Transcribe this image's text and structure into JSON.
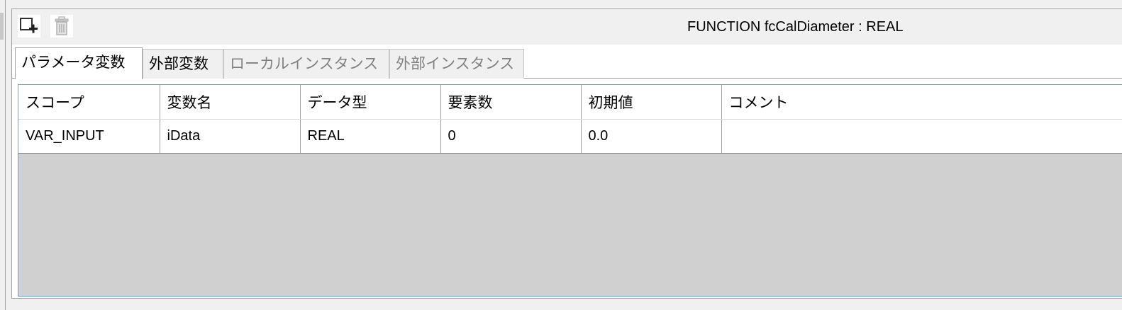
{
  "toolbar": {
    "add_icon": "add-row-icon",
    "delete_icon": "trash-icon"
  },
  "title": "FUNCTION fcCalDiameter : REAL",
  "tabs": [
    {
      "label": "パラメータ変数",
      "state": "active"
    },
    {
      "label": "外部変数",
      "state": "normal"
    },
    {
      "label": "ローカルインスタンス",
      "state": "disabled"
    },
    {
      "label": "外部インスタンス",
      "state": "disabled"
    }
  ],
  "table": {
    "columns": [
      "スコープ",
      "変数名",
      "データ型",
      "要素数",
      "初期値",
      "コメント"
    ],
    "rows": [
      [
        "VAR_INPUT",
        "iData",
        "REAL",
        "0",
        "0.0",
        ""
      ]
    ]
  },
  "colors": {
    "grid_border": "#7a9ac8",
    "empty_area": "#d0d0d0"
  }
}
